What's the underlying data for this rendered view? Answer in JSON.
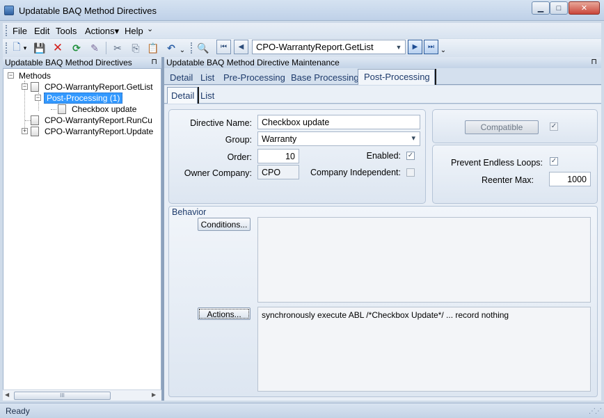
{
  "window": {
    "title": "Updatable BAQ Method Directives",
    "minimize_glyph": "▁",
    "maximize_glyph": "□",
    "close_glyph": "✕"
  },
  "menu": {
    "items": [
      "File",
      "Edit",
      "Tools",
      "Actions▾",
      "Help"
    ],
    "overflow": "⌄"
  },
  "toolbar": {
    "icons": {
      "new": "🗋",
      "new_dropdown": "▾",
      "save": "💾",
      "delete": "✕",
      "refresh": "⟳",
      "clear": "✎",
      "cut": "✂",
      "copy": "⎘",
      "paste": "📋",
      "undo": "↶",
      "undo_overflow": "⌄",
      "search": "🔍"
    },
    "search_value": "CPO-WarrantyReport.GetList",
    "nav": {
      "first": "⏮",
      "prev": "◀",
      "next": "▶",
      "last": "⏭",
      "overflow": "⌄"
    }
  },
  "left_pane": {
    "title": "Updatable BAQ Method Directives",
    "pin": "⊓",
    "tree": {
      "root": "Methods",
      "nodes": [
        "CPO-WarrantyReport.GetList",
        "Post-Processing (1)",
        "Checkbox update",
        "CPO-WarrantyReport.RunCu",
        "CPO-WarrantyReport.Update"
      ]
    },
    "scroll": {
      "left": "◀",
      "right": "▶",
      "thumb": "III"
    }
  },
  "right_pane": {
    "title": "Updatable BAQ Method Directive Maintenance",
    "pin": "⊓",
    "tabs": [
      "Detail",
      "List",
      "Pre-Processing",
      "Base Processing",
      "Post-Processing"
    ],
    "active_tab": "Post-Processing",
    "sub_tabs": [
      "Detail",
      "List"
    ],
    "active_sub_tab": "Detail"
  },
  "form": {
    "directive_name_label": "Directive Name:",
    "directive_name": "Checkbox update",
    "group_label": "Group:",
    "group": "Warranty",
    "group_arrow": "▾",
    "order_label": "Order:",
    "order": "10",
    "enabled_label": "Enabled:",
    "enabled": "✓",
    "owner_company_label": "Owner Company:",
    "owner_company": "CPO",
    "company_independent_label": "Company Independent:",
    "compatible_button": "Compatible",
    "compatible": "✓",
    "prevent_endless_loops_label": "Prevent Endless Loops:",
    "prevent_endless_loops": "✓",
    "reenter_max_label": "Reenter Max:",
    "reenter_max": "1000"
  },
  "behavior": {
    "title": "Behavior",
    "conditions_button": "Conditions...",
    "conditions_text": "",
    "actions_button": "Actions...",
    "actions_text": "synchronously execute ABL /*Checkbox Update*/ ... record nothing"
  },
  "status": {
    "text": "Ready",
    "grip": "⋰⋰"
  }
}
